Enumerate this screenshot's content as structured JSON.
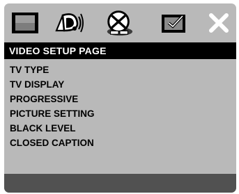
{
  "icons": [
    {
      "name": "general-setup-icon",
      "color": "#000000"
    },
    {
      "name": "audio-setup-icon",
      "color": "#000000"
    },
    {
      "name": "video-setup-icon",
      "color": "#000000",
      "selected": true
    },
    {
      "name": "preference-icon",
      "color": "#000000"
    },
    {
      "name": "exit-icon",
      "color": "#ffffff"
    }
  ],
  "header": {
    "title": "VIDEO SETUP PAGE"
  },
  "menu": {
    "items": [
      "TV TYPE",
      "TV DISPLAY",
      "PROGRESSIVE",
      "PICTURE SETTING",
      "BLACK LEVEL",
      "CLOSED CAPTION"
    ]
  },
  "colors": {
    "background": "#b9b9b9",
    "header_bg": "#000000",
    "header_text": "#ffffff",
    "footer_bg": "#515151",
    "selected_icon_plate": "#3d3d3d"
  }
}
